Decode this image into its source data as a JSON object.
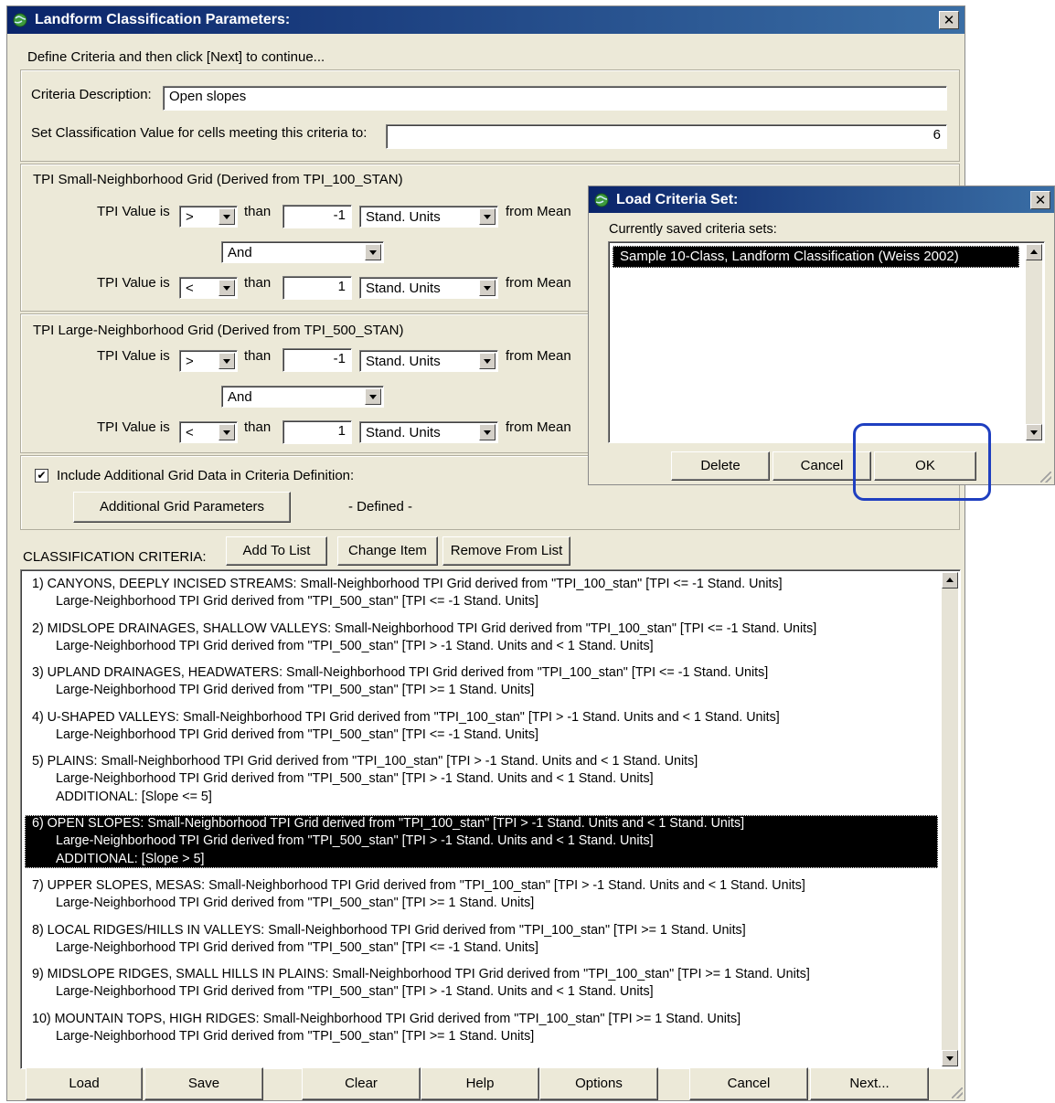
{
  "main_window": {
    "title": "Landform Classification Parameters:",
    "instruction": "Define Criteria and then click [Next] to continue...",
    "criteria_description_label": "Criteria Description:",
    "criteria_description_value": "Open slopes",
    "classification_value_label": "Set Classification Value for cells meeting this criteria to:",
    "classification_value": "6"
  },
  "small_grid": {
    "title": "TPI Small-Neighborhood Grid (Derived from TPI_100_STAN)",
    "row1": {
      "label": "TPI Value is",
      "operator": ">",
      "than": "than",
      "value": "-1",
      "units": "Stand. Units",
      "from": "from Mean"
    },
    "conjunction": "And",
    "row2": {
      "label": "TPI Value is",
      "operator": "<",
      "than": "than",
      "value": "1",
      "units": "Stand. Units",
      "from": "from Mean"
    }
  },
  "large_grid": {
    "title": "TPI Large-Neighborhood Grid (Derived from TPI_500_STAN)",
    "row1": {
      "label": "TPI Value is",
      "operator": ">",
      "than": "than",
      "value": "-1",
      "units": "Stand. Units",
      "from": "from Mean"
    },
    "conjunction": "And",
    "row2": {
      "label": "TPI Value is",
      "operator": "<",
      "than": "than",
      "value": "1",
      "units": "Stand. Units",
      "from": "from Mean"
    }
  },
  "additional": {
    "checkbox_label": "Include Additional Grid Data in Criteria Definition:",
    "checked": true,
    "check_mark": "✔",
    "button_label": "Additional Grid Parameters",
    "status": "- Defined -"
  },
  "criteria_list": {
    "label": "CLASSIFICATION CRITERIA:",
    "add_button": "Add To List",
    "change_button": "Change Item",
    "remove_button": "Remove From List",
    "items": [
      {
        "line1": "1) CANYONS, DEEPLY INCISED STREAMS: Small-Neighborhood TPI Grid derived from \"TPI_100_stan\"  [TPI  <= -1  Stand. Units]",
        "line2": "Large-Neighborhood TPI Grid derived from \"TPI_500_stan\" [TPI  <= -1  Stand. Units]",
        "line3": ""
      },
      {
        "line1": "2) MIDSLOPE DRAINAGES, SHALLOW VALLEYS: Small-Neighborhood TPI Grid derived from \"TPI_100_stan\"  [TPI  <= -1  Stand. Units]",
        "line2": "Large-Neighborhood TPI Grid derived from \"TPI_500_stan\" [TPI  > -1  Stand. Units and  < 1  Stand. Units]",
        "line3": ""
      },
      {
        "line1": "3) UPLAND DRAINAGES, HEADWATERS: Small-Neighborhood TPI Grid derived from \"TPI_100_stan\"  [TPI  <= -1  Stand. Units]",
        "line2": "Large-Neighborhood TPI Grid derived from \"TPI_500_stan\" [TPI  >= 1  Stand. Units]",
        "line3": ""
      },
      {
        "line1": "4) U-SHAPED VALLEYS: Small-Neighborhood TPI Grid derived from \"TPI_100_stan\"  [TPI  > -1  Stand. Units and  < 1  Stand. Units]",
        "line2": "Large-Neighborhood TPI Grid derived from \"TPI_500_stan\" [TPI  <= -1  Stand. Units]",
        "line3": ""
      },
      {
        "line1": "5) PLAINS: Small-Neighborhood TPI Grid derived from \"TPI_100_stan\"  [TPI  > -1  Stand. Units and  < 1  Stand. Units]",
        "line2": "Large-Neighborhood TPI Grid derived from \"TPI_500_stan\" [TPI  > -1  Stand. Units and  < 1  Stand. Units]",
        "line3": "ADDITIONAL: [Slope  <= 5]"
      },
      {
        "line1": "6) OPEN SLOPES: Small-Neighborhood TPI Grid derived from \"TPI_100_stan\"  [TPI  > -1  Stand. Units and  < 1  Stand. Units]",
        "line2": "Large-Neighborhood TPI Grid derived from \"TPI_500_stan\" [TPI  > -1  Stand. Units and  < 1  Stand. Units]",
        "line3": "ADDITIONAL: [Slope  > 5]"
      },
      {
        "line1": "7) UPPER SLOPES, MESAS: Small-Neighborhood TPI Grid derived from \"TPI_100_stan\"  [TPI  > -1  Stand. Units and  < 1  Stand. Units]",
        "line2": "Large-Neighborhood TPI Grid derived from \"TPI_500_stan\" [TPI  >= 1  Stand. Units]",
        "line3": ""
      },
      {
        "line1": "8) LOCAL RIDGES/HILLS IN VALLEYS: Small-Neighborhood TPI Grid derived from \"TPI_100_stan\"  [TPI  >= 1  Stand. Units]",
        "line2": "Large-Neighborhood TPI Grid derived from \"TPI_500_stan\" [TPI  <= -1  Stand. Units]",
        "line3": ""
      },
      {
        "line1": "9) MIDSLOPE RIDGES, SMALL HILLS IN PLAINS: Small-Neighborhood TPI Grid derived from \"TPI_100_stan\"  [TPI  >= 1  Stand. Units]",
        "line2": "Large-Neighborhood TPI Grid derived from \"TPI_500_stan\" [TPI  > -1  Stand. Units and  < 1  Stand. Units]",
        "line3": ""
      },
      {
        "line1": "10) MOUNTAIN TOPS, HIGH RIDGES: Small-Neighborhood TPI Grid derived from \"TPI_100_stan\"  [TPI  >= 1  Stand. Units]",
        "line2": "Large-Neighborhood TPI Grid derived from \"TPI_500_stan\" [TPI  >= 1  Stand. Units]",
        "line3": ""
      }
    ]
  },
  "footer_buttons": {
    "load": "Load",
    "save": "Save",
    "clear": "Clear",
    "help": "Help",
    "options": "Options",
    "cancel": "Cancel",
    "next": "Next..."
  },
  "load_dialog": {
    "title": "Load Criteria Set:",
    "list_label": "Currently saved criteria sets:",
    "items": [
      "Sample 10-Class, Landform Classification (Weiss 2002)"
    ],
    "delete_button": "Delete",
    "cancel_button": "Cancel",
    "ok_button": "OK"
  },
  "icons": {
    "close": "✕",
    "app_icon": "globe-icon"
  },
  "colors": {
    "title_bar_start": "#0a246a",
    "title_bar_end": "#3a6ea5",
    "dialog_face": "#ece9d8",
    "selection": "#000000",
    "annotation_highlight": "#1f3fc0"
  }
}
